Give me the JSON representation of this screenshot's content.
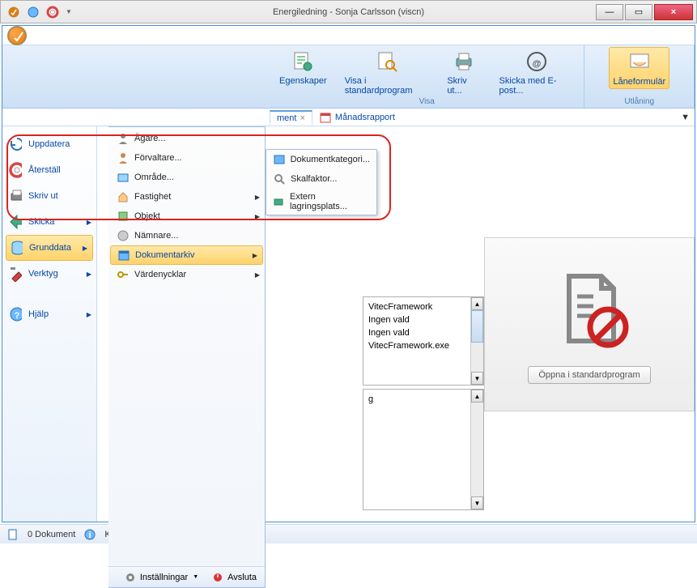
{
  "window": {
    "title": "Energiledning - Sonja Carlsson (viscn)",
    "min": "—",
    "max": "▭",
    "close": "×"
  },
  "ribbon": {
    "items": [
      {
        "label": "Egenskaper"
      },
      {
        "label": "Visa i standardprogram"
      },
      {
        "label": "Skriv ut..."
      },
      {
        "label": "Skicka med E-post..."
      },
      {
        "label": "Låneformulär"
      }
    ],
    "group_visa": "Visa",
    "group_utlaning": "Utlåning"
  },
  "tabs": {
    "active": "ment",
    "close": "×",
    "other": "Månadsrapport"
  },
  "rail": {
    "items": [
      {
        "label": "Uppdatera"
      },
      {
        "label": "Återställ"
      },
      {
        "label": "Skriv ut"
      },
      {
        "label": "Skicka",
        "arrow": true
      },
      {
        "label": "Grunddata",
        "arrow": true,
        "selected": true
      },
      {
        "label": "Verktyg",
        "arrow": true
      },
      {
        "label": "Hjälp",
        "arrow": true
      }
    ]
  },
  "menu1": {
    "items": [
      {
        "label": "Ägare..."
      },
      {
        "label": "Förvaltare..."
      },
      {
        "label": "Område..."
      },
      {
        "label": "Fastighet",
        "arrow": true
      },
      {
        "label": "Objekt",
        "arrow": true
      },
      {
        "label": "Nämnare..."
      },
      {
        "label": "Dokumentarkiv",
        "arrow": true,
        "selected": true
      },
      {
        "label": "Värdenycklar",
        "arrow": true
      }
    ],
    "footer": {
      "settings": "Inställningar",
      "exit": "Avsluta"
    }
  },
  "menu2": {
    "items": [
      {
        "label": "Dokumentkategori..."
      },
      {
        "label": "Skalfaktor..."
      },
      {
        "label": "Extern lagringsplats..."
      }
    ]
  },
  "listbox": {
    "lines": [
      "VitecFramework",
      "",
      "Ingen vald",
      "Ingen vald",
      "VitecFramework.exe"
    ],
    "trail": "g"
  },
  "preview": {
    "button": "Öppna i standardprogram"
  },
  "status": {
    "docs": "0 Dokument",
    "ready": "Klar"
  }
}
